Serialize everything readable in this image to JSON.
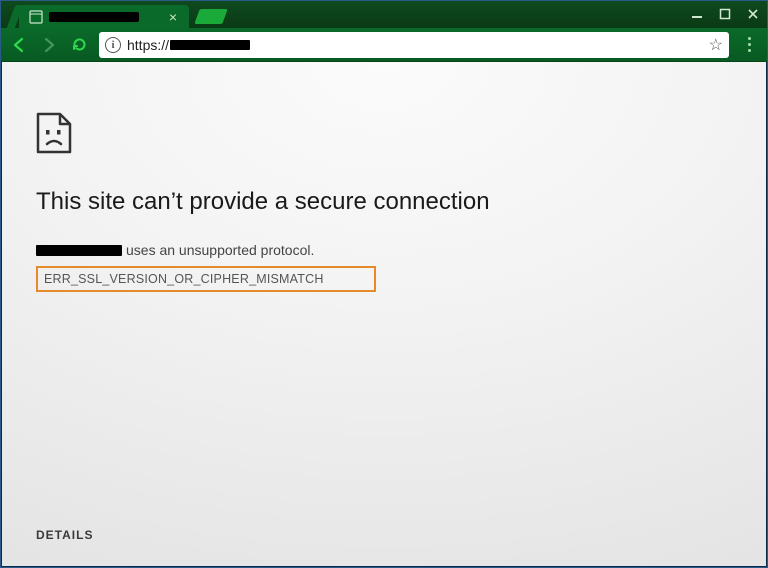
{
  "window": {
    "minimize_tip": "Minimize",
    "maximize_tip": "Maximize",
    "close_tip": "Close"
  },
  "tab": {
    "title_redacted": true,
    "close_tip": "Close tab"
  },
  "toolbar": {
    "back_tip": "Back",
    "forward_tip": "Forward",
    "reload_tip": "Reload",
    "url_prefix": "https://",
    "url_host_redacted": true,
    "star_tip": "Bookmark this page",
    "menu_tip": "Customize and control"
  },
  "page": {
    "heading": "This site can’t provide a secure connection",
    "sub_suffix": "uses an unsupported protocol.",
    "error_code": "ERR_SSL_VERSION_OR_CIPHER_MISMATCH",
    "details_label": "DETAILS"
  }
}
